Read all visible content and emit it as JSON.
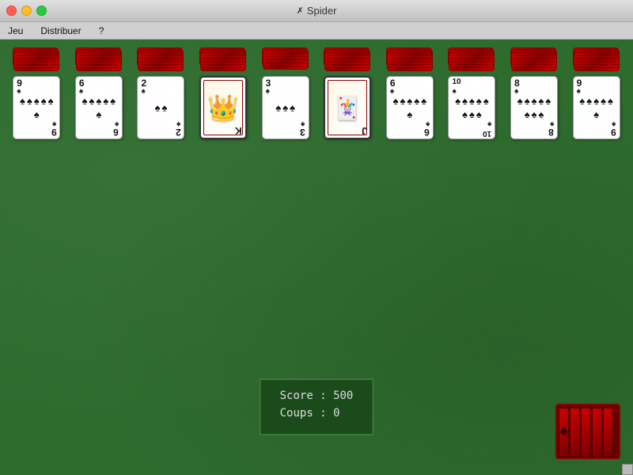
{
  "window": {
    "title": "Spider",
    "title_icon": "✗"
  },
  "menu": {
    "items": [
      "Jeu",
      "Distribuer",
      "?"
    ]
  },
  "columns": [
    {
      "id": 0,
      "back_count": 4,
      "top_rank": "9",
      "top_suit": "♠",
      "pip_count": 6
    },
    {
      "id": 1,
      "back_count": 4,
      "top_rank": "6",
      "top_suit": "♠",
      "pip_count": 6
    },
    {
      "id": 2,
      "back_count": 4,
      "top_rank": "2",
      "top_suit": "♠",
      "pip_count": 2
    },
    {
      "id": 3,
      "back_count": 4,
      "top_rank": "K",
      "top_suit": "♠",
      "pip_count": 0,
      "face": true,
      "face_type": "king"
    },
    {
      "id": 4,
      "back_count": 3,
      "top_rank": "3",
      "top_suit": "♠",
      "pip_count": 3
    },
    {
      "id": 5,
      "back_count": 4,
      "top_rank": "J",
      "top_suit": "♠",
      "pip_count": 0,
      "face": true,
      "face_type": "jack"
    },
    {
      "id": 6,
      "back_count": 4,
      "top_rank": "6",
      "top_suit": "♠",
      "pip_count": 6
    },
    {
      "id": 7,
      "back_count": 4,
      "top_rank": "10",
      "top_suit": "♠",
      "pip_count": 10
    },
    {
      "id": 8,
      "back_count": 4,
      "top_rank": "8",
      "top_suit": "♠",
      "pip_count": 8
    },
    {
      "id": 9,
      "back_count": 4,
      "top_rank": "9",
      "top_suit": "♠",
      "pip_count": 6
    }
  ],
  "score": {
    "label_score": "Score :",
    "value_score": "500",
    "label_coups": "Coups :",
    "value_coups": "0"
  },
  "stock": {
    "card_count": 5
  }
}
